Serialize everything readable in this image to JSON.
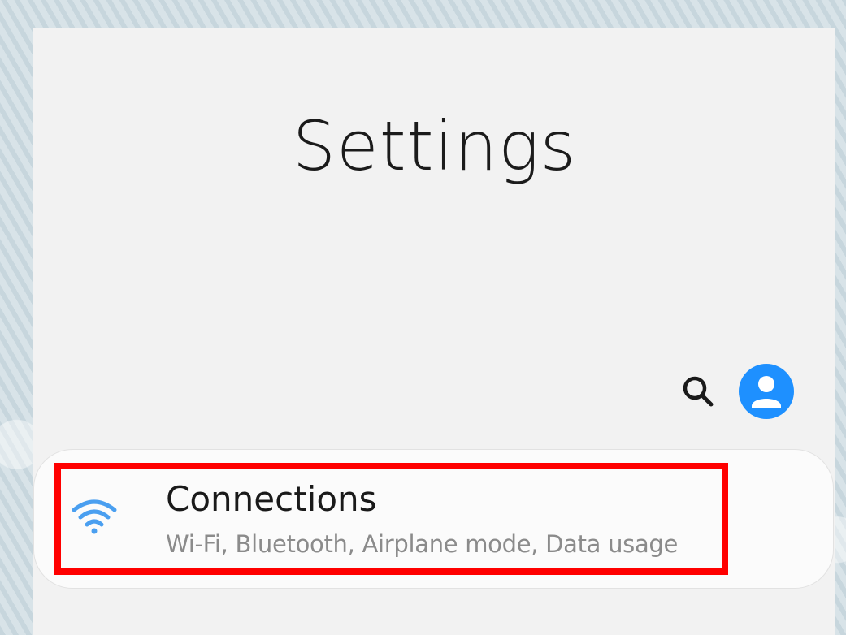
{
  "page": {
    "title": "Settings"
  },
  "toolbar": {
    "search_icon": "search-icon",
    "account_icon": "account-circle-icon"
  },
  "settings_list": {
    "items": [
      {
        "icon": "wifi-icon",
        "title": "Connections",
        "subtitle": "Wi-Fi, Bluetooth, Airplane mode, Data usage",
        "highlighted": true
      }
    ]
  },
  "colors": {
    "background": "#f2f2f2",
    "card": "#fbfbfb",
    "title_text": "#1b1b1b",
    "subtitle_text": "#8b8b8b",
    "accent_blue": "#1e90ff",
    "wifi_blue": "#4a9ff0",
    "highlight": "#ff0000"
  }
}
